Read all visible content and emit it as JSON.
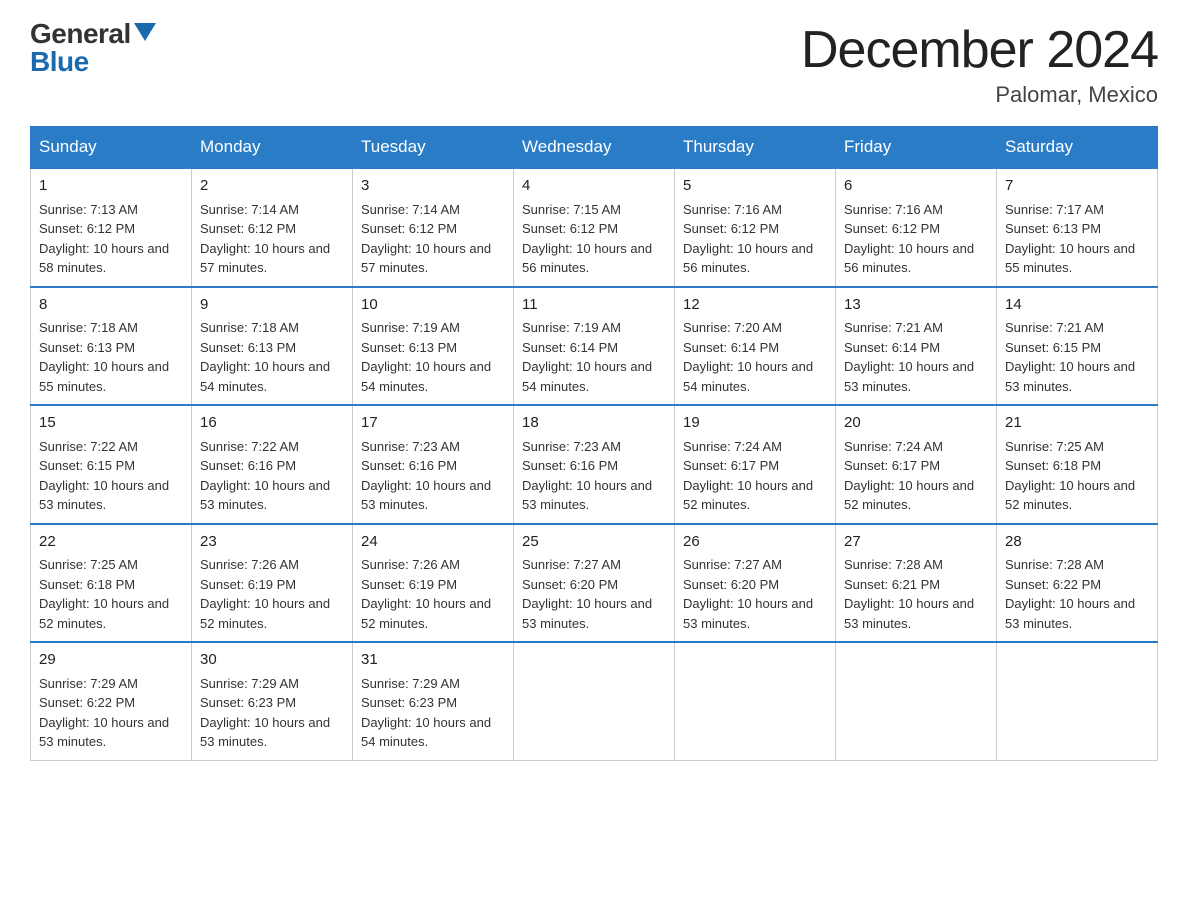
{
  "header": {
    "logo_general": "General",
    "logo_blue": "Blue",
    "month_title": "December 2024",
    "location": "Palomar, Mexico"
  },
  "columns": [
    "Sunday",
    "Monday",
    "Tuesday",
    "Wednesday",
    "Thursday",
    "Friday",
    "Saturday"
  ],
  "weeks": [
    [
      {
        "day": "1",
        "sunrise": "7:13 AM",
        "sunset": "6:12 PM",
        "daylight": "10 hours and 58 minutes."
      },
      {
        "day": "2",
        "sunrise": "7:14 AM",
        "sunset": "6:12 PM",
        "daylight": "10 hours and 57 minutes."
      },
      {
        "day": "3",
        "sunrise": "7:14 AM",
        "sunset": "6:12 PM",
        "daylight": "10 hours and 57 minutes."
      },
      {
        "day": "4",
        "sunrise": "7:15 AM",
        "sunset": "6:12 PM",
        "daylight": "10 hours and 56 minutes."
      },
      {
        "day": "5",
        "sunrise": "7:16 AM",
        "sunset": "6:12 PM",
        "daylight": "10 hours and 56 minutes."
      },
      {
        "day": "6",
        "sunrise": "7:16 AM",
        "sunset": "6:12 PM",
        "daylight": "10 hours and 56 minutes."
      },
      {
        "day": "7",
        "sunrise": "7:17 AM",
        "sunset": "6:13 PM",
        "daylight": "10 hours and 55 minutes."
      }
    ],
    [
      {
        "day": "8",
        "sunrise": "7:18 AM",
        "sunset": "6:13 PM",
        "daylight": "10 hours and 55 minutes."
      },
      {
        "day": "9",
        "sunrise": "7:18 AM",
        "sunset": "6:13 PM",
        "daylight": "10 hours and 54 minutes."
      },
      {
        "day": "10",
        "sunrise": "7:19 AM",
        "sunset": "6:13 PM",
        "daylight": "10 hours and 54 minutes."
      },
      {
        "day": "11",
        "sunrise": "7:19 AM",
        "sunset": "6:14 PM",
        "daylight": "10 hours and 54 minutes."
      },
      {
        "day": "12",
        "sunrise": "7:20 AM",
        "sunset": "6:14 PM",
        "daylight": "10 hours and 54 minutes."
      },
      {
        "day": "13",
        "sunrise": "7:21 AM",
        "sunset": "6:14 PM",
        "daylight": "10 hours and 53 minutes."
      },
      {
        "day": "14",
        "sunrise": "7:21 AM",
        "sunset": "6:15 PM",
        "daylight": "10 hours and 53 minutes."
      }
    ],
    [
      {
        "day": "15",
        "sunrise": "7:22 AM",
        "sunset": "6:15 PM",
        "daylight": "10 hours and 53 minutes."
      },
      {
        "day": "16",
        "sunrise": "7:22 AM",
        "sunset": "6:16 PM",
        "daylight": "10 hours and 53 minutes."
      },
      {
        "day": "17",
        "sunrise": "7:23 AM",
        "sunset": "6:16 PM",
        "daylight": "10 hours and 53 minutes."
      },
      {
        "day": "18",
        "sunrise": "7:23 AM",
        "sunset": "6:16 PM",
        "daylight": "10 hours and 53 minutes."
      },
      {
        "day": "19",
        "sunrise": "7:24 AM",
        "sunset": "6:17 PM",
        "daylight": "10 hours and 52 minutes."
      },
      {
        "day": "20",
        "sunrise": "7:24 AM",
        "sunset": "6:17 PM",
        "daylight": "10 hours and 52 minutes."
      },
      {
        "day": "21",
        "sunrise": "7:25 AM",
        "sunset": "6:18 PM",
        "daylight": "10 hours and 52 minutes."
      }
    ],
    [
      {
        "day": "22",
        "sunrise": "7:25 AM",
        "sunset": "6:18 PM",
        "daylight": "10 hours and 52 minutes."
      },
      {
        "day": "23",
        "sunrise": "7:26 AM",
        "sunset": "6:19 PM",
        "daylight": "10 hours and 52 minutes."
      },
      {
        "day": "24",
        "sunrise": "7:26 AM",
        "sunset": "6:19 PM",
        "daylight": "10 hours and 52 minutes."
      },
      {
        "day": "25",
        "sunrise": "7:27 AM",
        "sunset": "6:20 PM",
        "daylight": "10 hours and 53 minutes."
      },
      {
        "day": "26",
        "sunrise": "7:27 AM",
        "sunset": "6:20 PM",
        "daylight": "10 hours and 53 minutes."
      },
      {
        "day": "27",
        "sunrise": "7:28 AM",
        "sunset": "6:21 PM",
        "daylight": "10 hours and 53 minutes."
      },
      {
        "day": "28",
        "sunrise": "7:28 AM",
        "sunset": "6:22 PM",
        "daylight": "10 hours and 53 minutes."
      }
    ],
    [
      {
        "day": "29",
        "sunrise": "7:29 AM",
        "sunset": "6:22 PM",
        "daylight": "10 hours and 53 minutes."
      },
      {
        "day": "30",
        "sunrise": "7:29 AM",
        "sunset": "6:23 PM",
        "daylight": "10 hours and 53 minutes."
      },
      {
        "day": "31",
        "sunrise": "7:29 AM",
        "sunset": "6:23 PM",
        "daylight": "10 hours and 54 minutes."
      },
      null,
      null,
      null,
      null
    ]
  ]
}
